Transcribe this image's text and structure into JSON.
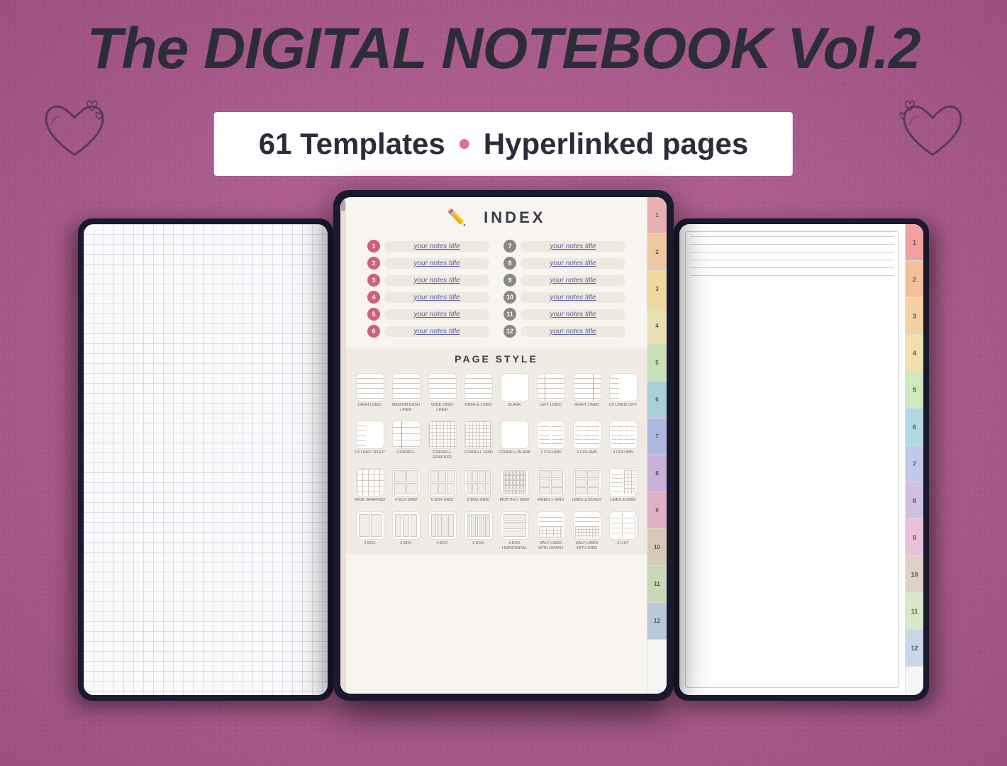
{
  "title": "The DIGITAL NOTEBOOK Vol.2",
  "subtitle": {
    "templates": "61 Templates",
    "separator": "●",
    "hyperlinked": "Hyperlinked pages"
  },
  "center_tablet": {
    "index": {
      "header": "✏️  INDEX",
      "items_left": [
        {
          "num": "1",
          "text": "your notes title"
        },
        {
          "num": "2",
          "text": "your notes title"
        },
        {
          "num": "3",
          "text": "your notes title"
        },
        {
          "num": "4",
          "text": "your notes title"
        },
        {
          "num": "5",
          "text": "your notes title"
        },
        {
          "num": "6",
          "text": "your notes title"
        }
      ],
      "items_right": [
        {
          "num": "7",
          "text": "your notes title"
        },
        {
          "num": "8",
          "text": "your notes title"
        },
        {
          "num": "9",
          "text": "your notes title"
        },
        {
          "num": "10",
          "text": "your notes title"
        },
        {
          "num": "11",
          "text": "your notes title"
        },
        {
          "num": "12",
          "text": "your notes title"
        }
      ]
    },
    "page_style": {
      "header": "PAGE STYLE",
      "row1": [
        {
          "label": "DASH LINED",
          "type": "dash-lined"
        },
        {
          "label": "MEDIUM DASH LINED",
          "type": "dash-lined"
        },
        {
          "label": "WIDE DASH LINED",
          "type": "dash-lined"
        },
        {
          "label": "DASH & LINED",
          "type": "dash-lined"
        },
        {
          "label": "BLANK",
          "type": "blank"
        },
        {
          "label": "LEFT LINED",
          "type": "left-lined"
        },
        {
          "label": "RIGHT LINED",
          "type": "right-lined"
        },
        {
          "label": "1/3 LINED LEFT",
          "type": "third-lined"
        }
      ],
      "row2": [
        {
          "label": "1/3 LINED RIGHT",
          "type": "third-lined"
        },
        {
          "label": "CORNELL",
          "type": "cornell"
        },
        {
          "label": "CORNELL GRAPHED",
          "type": "cornell-graphed"
        },
        {
          "label": "CORNELL GRID",
          "type": "cornell-grid"
        },
        {
          "label": "CORNELL BLANK",
          "type": "cornell-blank"
        },
        {
          "label": "2 COLUMN",
          "type": "2col"
        },
        {
          "label": "3 COLUMN",
          "type": "3col"
        },
        {
          "label": "4 COLUMN",
          "type": "4col"
        }
      ],
      "row3": [
        {
          "label": "WIDE GRAPHED",
          "type": "wide-graphed"
        },
        {
          "label": "4 BOX GRID",
          "type": "4box"
        },
        {
          "label": "6 BOX GRID",
          "type": "6box"
        },
        {
          "label": "8 BOX GRID",
          "type": "8box"
        },
        {
          "label": "MONTHLY GRID",
          "type": "monthly"
        },
        {
          "label": "WEEKLY GRID",
          "type": "weekly"
        },
        {
          "label": "LINES & BOXES",
          "type": "lines-boxes"
        },
        {
          "label": "LINES & GRID",
          "type": "lines-grid"
        }
      ],
      "row4": [
        {
          "label": "2 BOX",
          "type": "2box"
        },
        {
          "label": "3 BOX",
          "type": "3box"
        },
        {
          "label": "4 BOX",
          "type": "4box2"
        },
        {
          "label": "6 BOX",
          "type": "6box2"
        },
        {
          "label": "3 BOX HORIZONTAL",
          "type": "3box-horiz"
        },
        {
          "label": "HALF LINED WITH GRAPH",
          "type": "half-lined-graph"
        },
        {
          "label": "HALF LINED WITH GRID",
          "type": "half-lined-grid"
        },
        {
          "label": "2 LIST",
          "type": "2list"
        }
      ]
    },
    "tabs": [
      "1",
      "2",
      "3",
      "4",
      "5",
      "6",
      "7",
      "8",
      "9",
      "10",
      "11",
      "12"
    ]
  },
  "right_tablet": {
    "tabs": [
      "1",
      "2",
      "3",
      "4",
      "5",
      "6",
      "7",
      "8",
      "9",
      "10",
      "11",
      "12"
    ]
  },
  "colors": {
    "background": "#c47fa0",
    "title": "#2d2d3a",
    "accent": "#e07090"
  }
}
